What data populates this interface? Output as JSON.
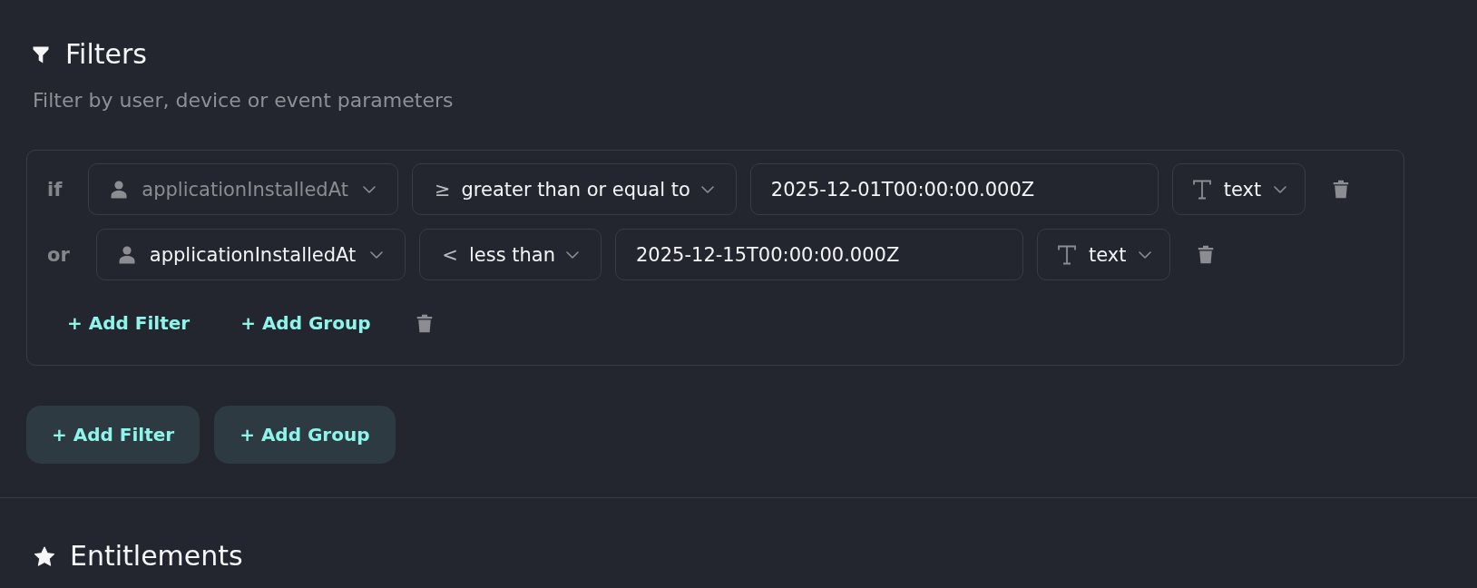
{
  "filters_section": {
    "title": "Filters",
    "subtitle": "Filter by user, device or event parameters"
  },
  "group": {
    "conditions": [
      {
        "connector": "if",
        "field": {
          "label": "applicationInstalledAt",
          "disabled": true
        },
        "operator": {
          "symbol": "≥",
          "label": "greater than or equal to"
        },
        "value": "2025-12-01T00:00:00.000Z",
        "type": {
          "kind": "text",
          "label": "text"
        }
      },
      {
        "connector": "or",
        "field": {
          "label": "applicationInstalledAt",
          "disabled": false
        },
        "operator": {
          "symbol": "<",
          "label": "less than"
        },
        "value": "2025-12-15T00:00:00.000Z",
        "type": {
          "kind": "text",
          "label": "text"
        }
      }
    ],
    "actions": [
      "+ Add Filter",
      "+ Add Group"
    ]
  },
  "buttons": [
    "+ Add Filter",
    "+ Add Group"
  ],
  "entitlements_section": {
    "title": "Entitlements"
  }
}
